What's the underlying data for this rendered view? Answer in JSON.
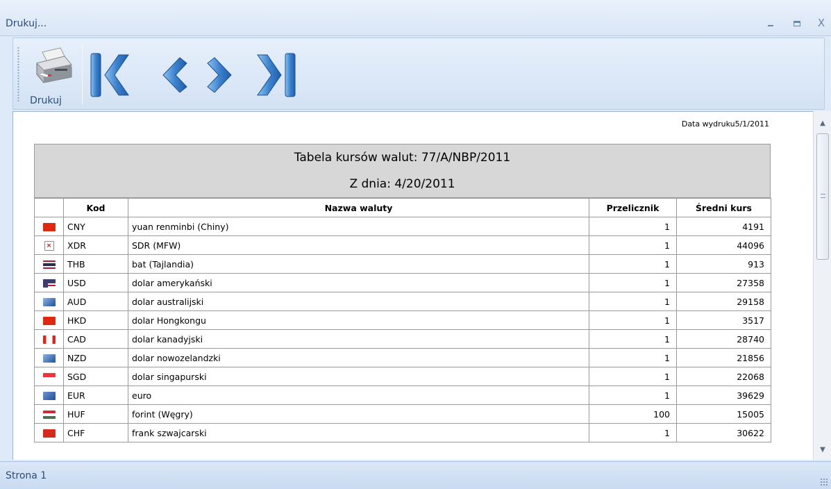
{
  "window": {
    "title": "Drukuj..."
  },
  "toolbar": {
    "print_label": "Drukuj",
    "icons": [
      "printer-icon",
      "first-page-icon",
      "previous-page-icon",
      "next-page-icon",
      "last-page-icon"
    ]
  },
  "report": {
    "print_date": "Data wydruku5/1/2011",
    "title": "Tabela kursów walut: 77/A/NBP/2011",
    "date_line": "Z dnia:  4/20/2011",
    "columns": [
      "",
      "Kod",
      "Nazwa waluty",
      "Przelicznik",
      "Średni kurs"
    ],
    "rows": [
      {
        "flag": "flag-cn",
        "code": "CNY",
        "name": "yuan renminbi (Chiny)",
        "multiplier": "1",
        "rate": "4191"
      },
      {
        "flag": "flag-missing",
        "code": "XDR",
        "name": "SDR (MFW)",
        "multiplier": "1",
        "rate": "44096"
      },
      {
        "flag": "flag-th",
        "code": "THB",
        "name": "bat (Tajlandia)",
        "multiplier": "1",
        "rate": "913"
      },
      {
        "flag": "flag-us",
        "code": "USD",
        "name": "dolar amerykański",
        "multiplier": "1",
        "rate": "27358"
      },
      {
        "flag": "flag-au",
        "code": "AUD",
        "name": "dolar australijski",
        "multiplier": "1",
        "rate": "29158"
      },
      {
        "flag": "flag-hk",
        "code": "HKD",
        "name": "dolar Hongkongu",
        "multiplier": "1",
        "rate": "3517"
      },
      {
        "flag": "flag-ca",
        "code": "CAD",
        "name": "dolar kanadyjski",
        "multiplier": "1",
        "rate": "28740"
      },
      {
        "flag": "flag-nz",
        "code": "NZD",
        "name": "dolar nowozelandzki",
        "multiplier": "1",
        "rate": "21856"
      },
      {
        "flag": "flag-sg",
        "code": "SGD",
        "name": "dolar singapurski",
        "multiplier": "1",
        "rate": "22068"
      },
      {
        "flag": "flag-eu",
        "code": "EUR",
        "name": "euro",
        "multiplier": "1",
        "rate": "39629"
      },
      {
        "flag": "flag-hu",
        "code": "HUF",
        "name": "forint (Węgry)",
        "multiplier": "100",
        "rate": "15005"
      },
      {
        "flag": "flag-ch",
        "code": "CHF",
        "name": "frank szwajcarski",
        "multiplier": "1",
        "rate": "30622"
      }
    ]
  },
  "statusbar": {
    "page_label": "Strona 1"
  },
  "colors": {
    "accent": "#2a4d7c",
    "nav_blue": "#2f6db3",
    "header_gray": "#d7d7d7"
  }
}
